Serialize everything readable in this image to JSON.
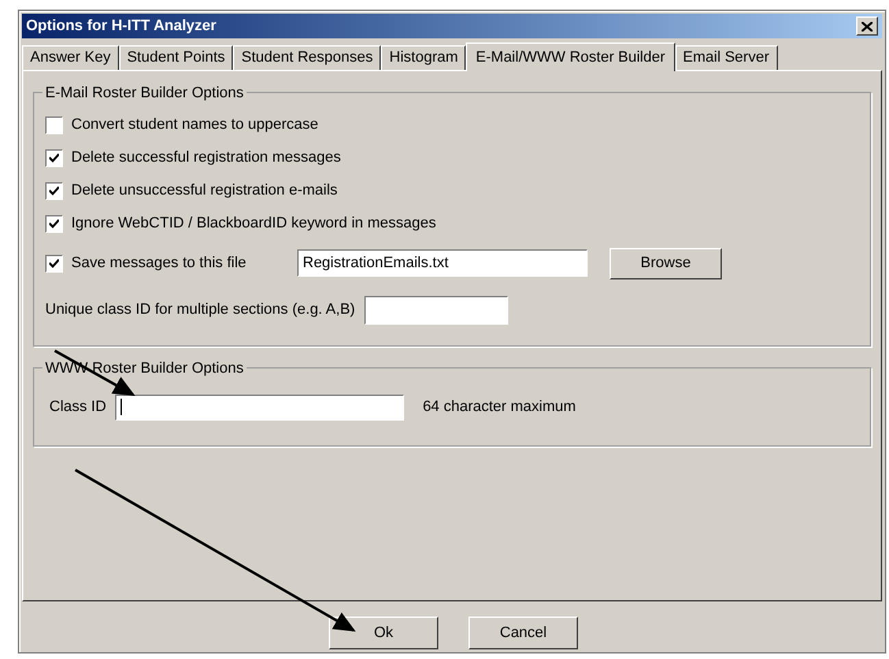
{
  "window": {
    "title": "Options for H-ITT Analyzer"
  },
  "tabs": [
    {
      "label": "Answer Key",
      "selected": false
    },
    {
      "label": "Student Points",
      "selected": false
    },
    {
      "label": "Student Responses",
      "selected": false
    },
    {
      "label": "Histogram",
      "selected": false
    },
    {
      "label": "E-Mail/WWW Roster Builder",
      "selected": true
    },
    {
      "label": "Email Server",
      "selected": false
    }
  ],
  "email_group": {
    "title": "E-Mail Roster Builder Options",
    "options": [
      {
        "label": "Convert student names to uppercase",
        "checked": false
      },
      {
        "label": "Delete successful registration messages",
        "checked": true
      },
      {
        "label": "Delete unsuccessful registration e-mails",
        "checked": true
      },
      {
        "label": "Ignore WebCTID / BlackboardID keyword in messages",
        "checked": true
      }
    ],
    "save_file": {
      "label": "Save messages to this file",
      "checked": true,
      "value": "RegistrationEmails.txt",
      "button": "Browse"
    },
    "unique_id": {
      "label": "Unique class ID for multiple sections (e.g. A,B)"
    }
  },
  "www_group": {
    "title": "WWW Roster Builder Options",
    "class_id": {
      "label": "Class ID",
      "hint": "64 character maximum"
    }
  },
  "buttons": [
    "Ok",
    "Cancel"
  ]
}
